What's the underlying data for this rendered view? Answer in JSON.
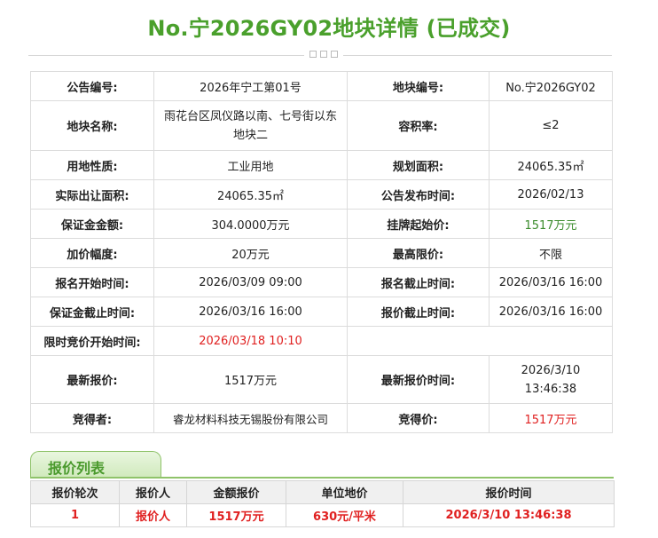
{
  "page": {
    "title": "No.宁2026GY02地块详情 (已成交)"
  },
  "details": {
    "rows": [
      {
        "l1": "公告编号:",
        "v1": "2026年宁工第01号",
        "l2": "地块编号:",
        "v2": "No.宁2026GY02"
      },
      {
        "l1": "地块名称:",
        "v1": "雨花台区凤仪路以南、七号街以东地块二",
        "l2": "容积率:",
        "v2": "≤2"
      },
      {
        "l1": "用地性质:",
        "v1": "工业用地",
        "l2": "规划面积:",
        "v2": "24065.35㎡"
      },
      {
        "l1": "实际出让面积:",
        "v1": "24065.35㎡",
        "l2": "公告发布时间:",
        "v2": "2026/02/13"
      },
      {
        "l1": "保证金金额:",
        "v1": "304.0000万元",
        "l2": "挂牌起始价:",
        "v2": "1517万元"
      },
      {
        "l1": "加价幅度:",
        "v1": "20万元",
        "l2": "最高限价:",
        "v2": "不限"
      },
      {
        "l1": "报名开始时间:",
        "v1": "2026/03/09 09:00",
        "l2": "报名截止时间:",
        "v2": "2026/03/16 16:00"
      },
      {
        "l1": "保证金截止时间:",
        "v1": "2026/03/16 16:00",
        "l2": "报价截止时间:",
        "v2": "2026/03/16 16:00"
      },
      {
        "l1": "限时竞价开始时间:",
        "v1": "2026/03/18 10:10",
        "l2": "",
        "v2": ""
      },
      {
        "l1": "最新报价:",
        "v1": "1517万元",
        "l2": "最新报价时间:",
        "v2": "2026/3/10 13:46:38"
      },
      {
        "l1": "竞得者:",
        "v1": "睿龙材料科技无锡股份有限公司",
        "l2": "竞得价:",
        "v2": "1517万元"
      }
    ]
  },
  "bid_section": {
    "title": "报价列表",
    "headers": [
      "报价轮次",
      "报价人",
      "金额报价",
      "单位地价",
      "报价时间"
    ],
    "rows": [
      [
        "1",
        "报价人",
        "1517万元",
        "630元/平米",
        "2026/3/10 13:46:38"
      ]
    ]
  },
  "colors": {
    "title_green": "#4aa02c",
    "value_green": "#3a8b2b",
    "value_red": "#e02020"
  }
}
